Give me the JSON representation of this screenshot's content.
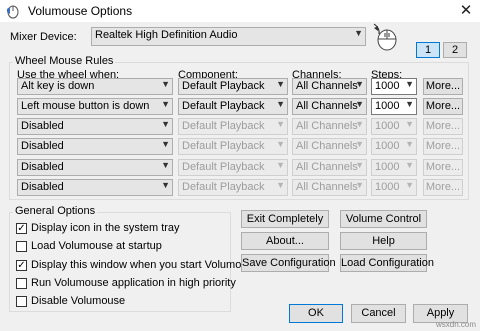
{
  "window": {
    "title": "Volumouse Options",
    "close_glyph": "✕"
  },
  "mixer": {
    "label": "Mixer Device:",
    "value": "Realtek High Definition Audio",
    "tabs": [
      "1",
      "2"
    ]
  },
  "rules": {
    "title": "Wheel Mouse Rules",
    "headers": {
      "when": "Use the wheel when:",
      "component": "Component:",
      "channels": "Channels:",
      "steps": "Steps:"
    },
    "rows": [
      {
        "when": "Alt key is down",
        "component": "Default Playback",
        "channels": "All Channels",
        "steps": "1000",
        "more": "More...",
        "enabled": true
      },
      {
        "when": "Left mouse button is down",
        "component": "Default Playback",
        "channels": "All Channels",
        "steps": "1000",
        "more": "More...",
        "enabled": true
      },
      {
        "when": "Disabled",
        "component": "Default Playback",
        "channels": "All Channels",
        "steps": "1000",
        "more": "More...",
        "enabled": false
      },
      {
        "when": "Disabled",
        "component": "Default Playback",
        "channels": "All Channels",
        "steps": "1000",
        "more": "More...",
        "enabled": false
      },
      {
        "when": "Disabled",
        "component": "Default Playback",
        "channels": "All Channels",
        "steps": "1000",
        "more": "More...",
        "enabled": false
      },
      {
        "when": "Disabled",
        "component": "Default Playback",
        "channels": "All Channels",
        "steps": "1000",
        "more": "More...",
        "enabled": false
      }
    ]
  },
  "general": {
    "title": "General Options",
    "options": [
      {
        "label": "Display icon in the system tray",
        "checked": true
      },
      {
        "label": "Load Volumouse at startup",
        "checked": false
      },
      {
        "label": "Display this window when you start Volumouse",
        "checked": true
      },
      {
        "label": "Run Volumouse application in high priority",
        "checked": false
      },
      {
        "label": "Disable Volumouse",
        "checked": false
      }
    ]
  },
  "actions": {
    "exit": "Exit Completely",
    "volume_control": "Volume Control",
    "about": "About...",
    "help": "Help",
    "save_config": "Save Configuration",
    "load_config": "Load Configuration"
  },
  "footer": {
    "ok": "OK",
    "cancel": "Cancel",
    "apply": "Apply"
  },
  "watermark": "wsxdn.com"
}
